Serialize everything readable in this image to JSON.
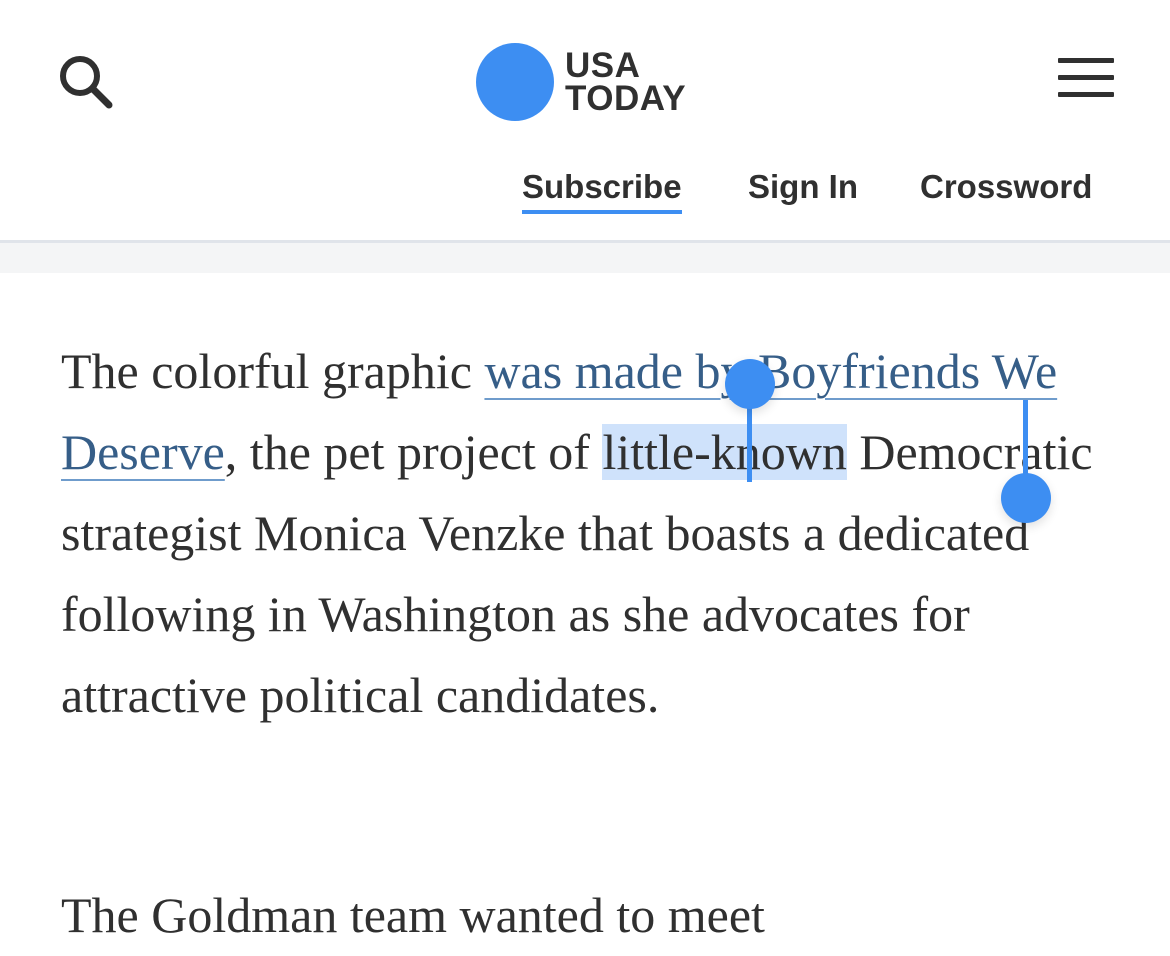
{
  "colors": {
    "accent": "#3d8ef2",
    "text": "#303030",
    "link": "#365e88",
    "selection": "#cfe2fb"
  },
  "header": {
    "search_icon": "search-icon",
    "logo": {
      "line1": "USA",
      "line2": "TODAY"
    },
    "menu_icon": "hamburger-menu-icon",
    "nav": {
      "subscribe": "Subscribe",
      "sign_in": "Sign In",
      "crossword": "Crossword"
    }
  },
  "article": {
    "p1": {
      "intro": "The colorful graphic ",
      "link_part1": "was made ",
      "link_part2": "by Boyfriends We Deserve",
      "mid": ", the pet project of ",
      "selected": "little-known",
      "rest": " Democratic strategist Monica Venzke that boasts a dedicated following in Washington as she advocates for attractive political candidates."
    },
    "next_paragraph_start": "The Goldman  team  wanted  to  meet"
  }
}
